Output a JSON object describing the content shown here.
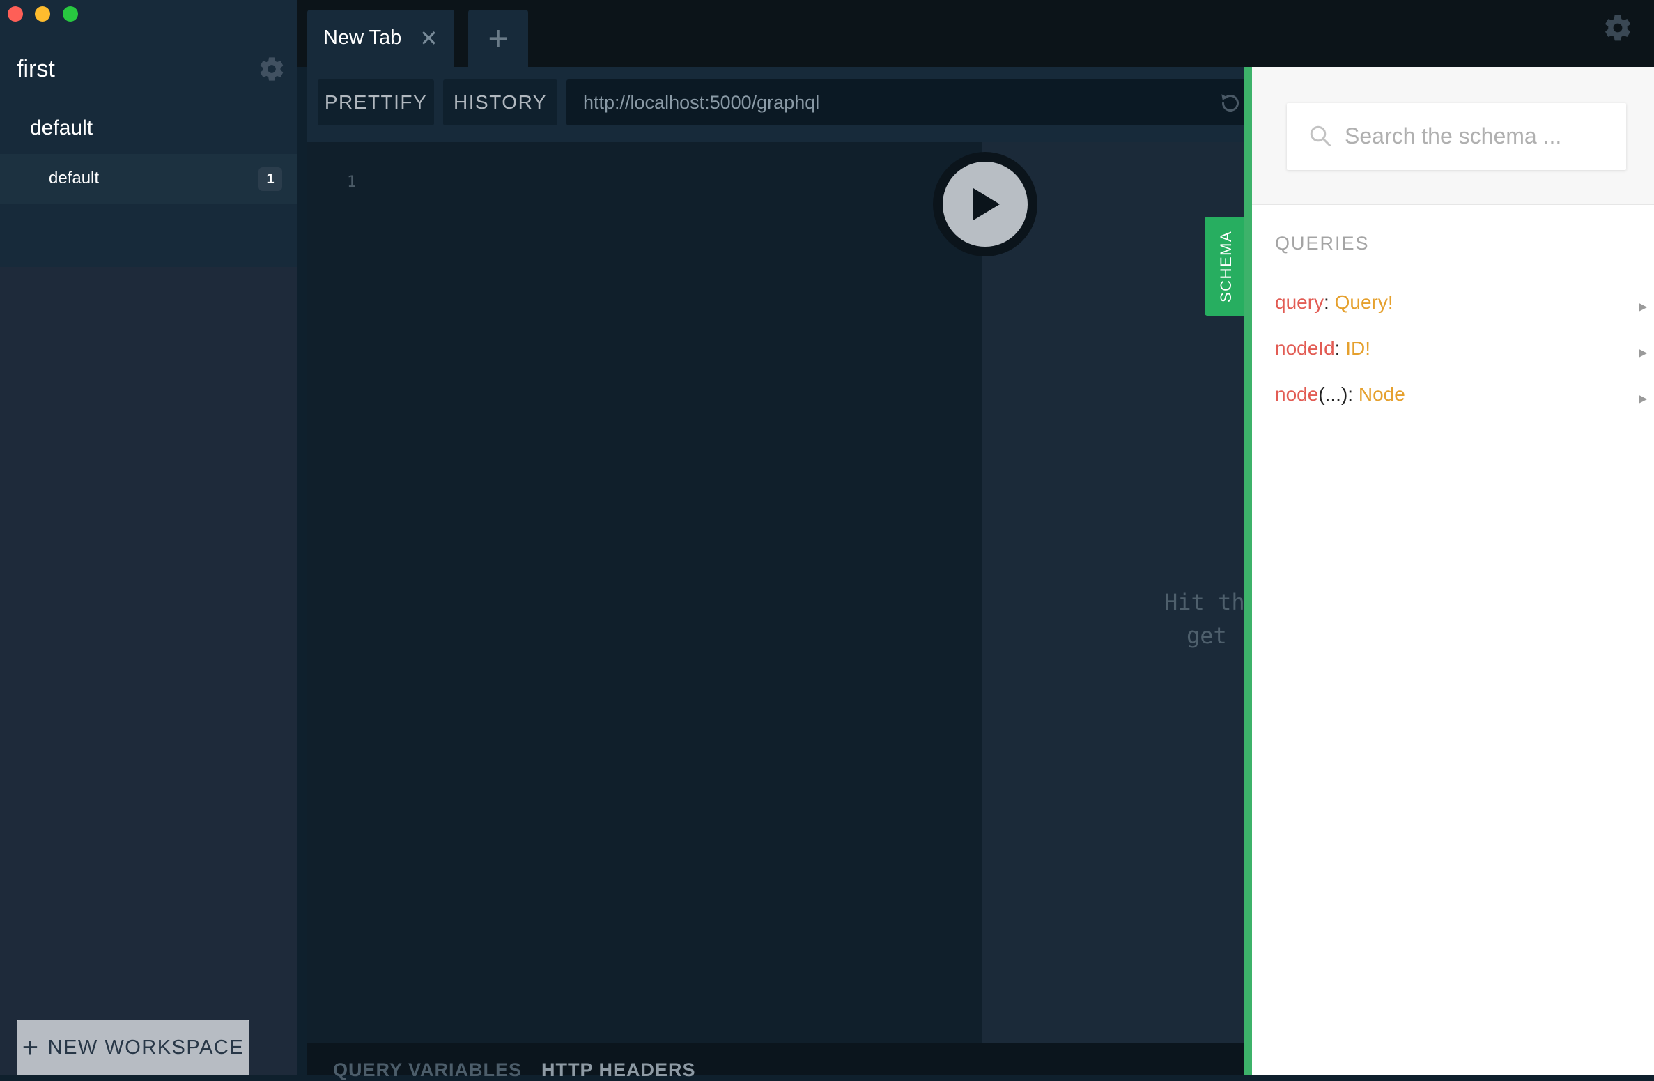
{
  "sidebar": {
    "project_title": "first",
    "workspace_group": "default",
    "workspace_item": "default",
    "workspace_count": "1",
    "new_workspace_label": "NEW WORKSPACE"
  },
  "tabs": [
    {
      "label": "New Tab"
    }
  ],
  "toolbar": {
    "prettify_label": "PRETTIFY",
    "history_label": "HISTORY",
    "endpoint_url": "http://localhost:5000/graphql"
  },
  "editor": {
    "line_number": "1"
  },
  "result": {
    "hint_line1": "Hit th",
    "hint_line2": "get"
  },
  "bottom_tabs": {
    "query_variables": "QUERY VARIABLES",
    "http_headers": "HTTP HEADERS"
  },
  "schema": {
    "tab_label": "SCHEMA",
    "search_placeholder": "Search the schema ...",
    "section_heading": "QUERIES",
    "fields": [
      {
        "name": "query",
        "args": "",
        "type": "Query!"
      },
      {
        "name": "nodeId",
        "args": "",
        "type": "ID!"
      },
      {
        "name": "node",
        "args": "(...)",
        "type": "Node"
      }
    ]
  },
  "colors": {
    "sidebar_bg": "#1e2a3a",
    "editor_bg": "#101f2b",
    "schema_accent": "#27ae60",
    "field_name": "#e25c54",
    "field_type": "#e5a02d"
  },
  "icons": [
    "gear-icon",
    "close-icon",
    "plus-icon",
    "reload-icon",
    "play-icon",
    "search-icon",
    "chevron-right-icon"
  ]
}
